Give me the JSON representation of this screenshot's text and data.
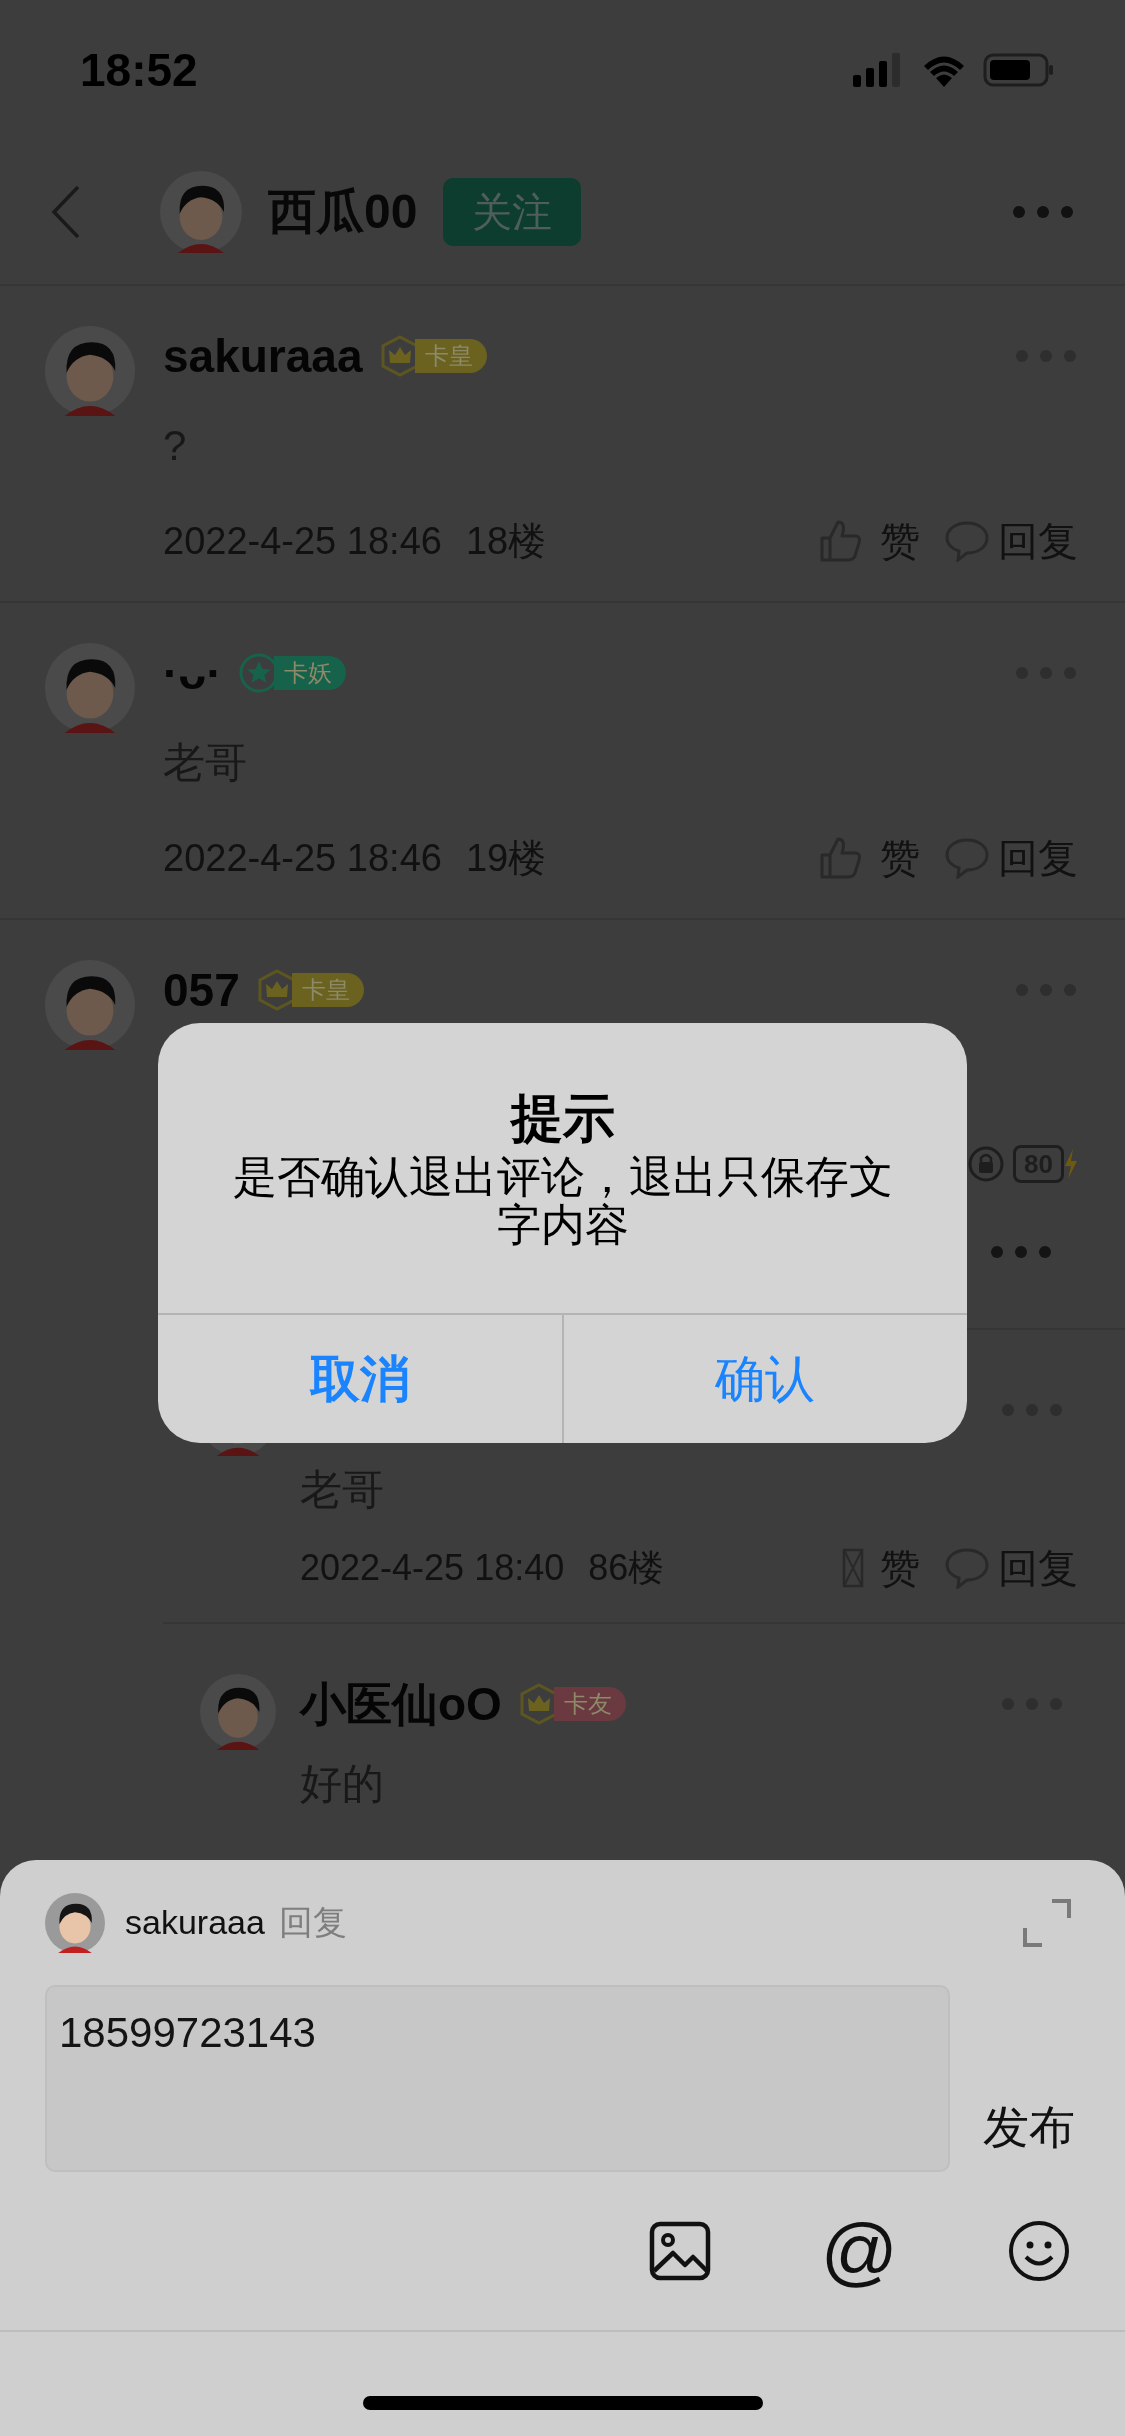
{
  "status_bar": {
    "time": "18:52"
  },
  "header": {
    "title": "西瓜00",
    "follow_button": "关注"
  },
  "comments": [
    {
      "user": "sakuraaa",
      "badge": {
        "kind": "crown",
        "label": "卡皇",
        "color": "#6b6220"
      },
      "text": "?",
      "time": "2022-4-25 18:46",
      "floor": "18楼",
      "like": "赞",
      "reply": "回复"
    },
    {
      "user": "·ᴗ·",
      "badge": {
        "kind": "star",
        "label": "卡妖",
        "color": "#17624a"
      },
      "text": "老哥",
      "time": "2022-4-25 18:46",
      "floor": "19楼",
      "like": "赞",
      "reply": "回复"
    },
    {
      "user": "057",
      "badge": {
        "kind": "crown",
        "label": "卡皇",
        "color": "#6b6220"
      },
      "level_badge": "80",
      "replies": [
        {
          "text": "老哥",
          "time": "2022-4-25 18:40",
          "floor": "86楼",
          "like": "赞",
          "reply": "回复"
        },
        {
          "user": "小医仙oO",
          "badge": {
            "kind": "crown",
            "label": "卡友",
            "color": "#6b3a40"
          },
          "text": "好的"
        }
      ]
    }
  ],
  "compose": {
    "user": "sakuraaa",
    "action": "回复",
    "value": "18599723143",
    "post_button": "发布",
    "mention_button": "@"
  },
  "dialog": {
    "title": "提示",
    "message": "是否确认退出评论，退出只保存文字内容",
    "buttons": [
      {
        "label": "取消",
        "kind": "cancel"
      },
      {
        "label": "确认",
        "kind": "confirm"
      }
    ]
  }
}
